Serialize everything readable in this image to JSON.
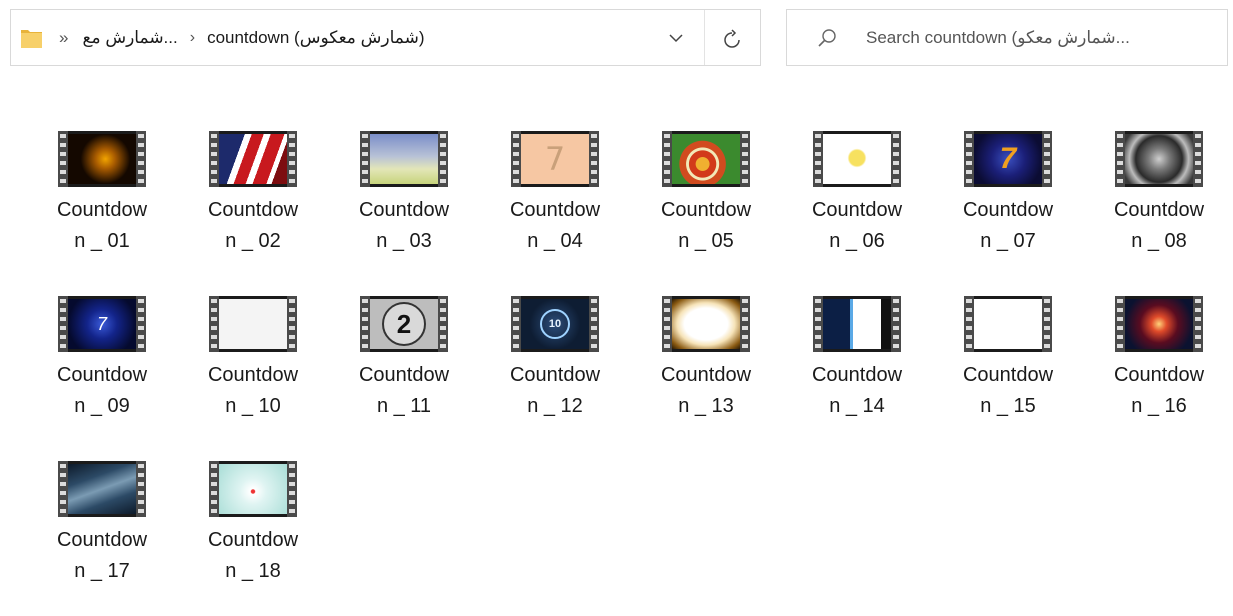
{
  "address_bar": {
    "overflow_label": "»",
    "crumbs": [
      "...شمارش مع",
      "countdown (شمارش معکوس)"
    ],
    "chevron": "›"
  },
  "search": {
    "placeholder": "Search countdown (شمارش معکو..."
  },
  "files": [
    {
      "name": "Countdown _ 01"
    },
    {
      "name": "Countdown _ 02"
    },
    {
      "name": "Countdown _ 03"
    },
    {
      "name": "Countdown _ 04"
    },
    {
      "name": "Countdown _ 05"
    },
    {
      "name": "Countdown _ 06"
    },
    {
      "name": "Countdown _ 07"
    },
    {
      "name": "Countdown _ 08"
    },
    {
      "name": "Countdown _ 09"
    },
    {
      "name": "Countdown _ 10"
    },
    {
      "name": "Countdown _ 11"
    },
    {
      "name": "Countdown _ 12"
    },
    {
      "name": "Countdown _ 13"
    },
    {
      "name": "Countdown _ 14"
    },
    {
      "name": "Countdown _ 15"
    },
    {
      "name": "Countdown _ 16"
    },
    {
      "name": "Countdown _ 17"
    },
    {
      "name": "Countdown _ 18"
    }
  ],
  "thumb_labels": {
    "t04": "7",
    "t07": "7",
    "t09": "7",
    "t11": "2",
    "t12": "10"
  },
  "colors": {
    "folder": "#f5c842",
    "film_strip": "#4a4a4a"
  }
}
